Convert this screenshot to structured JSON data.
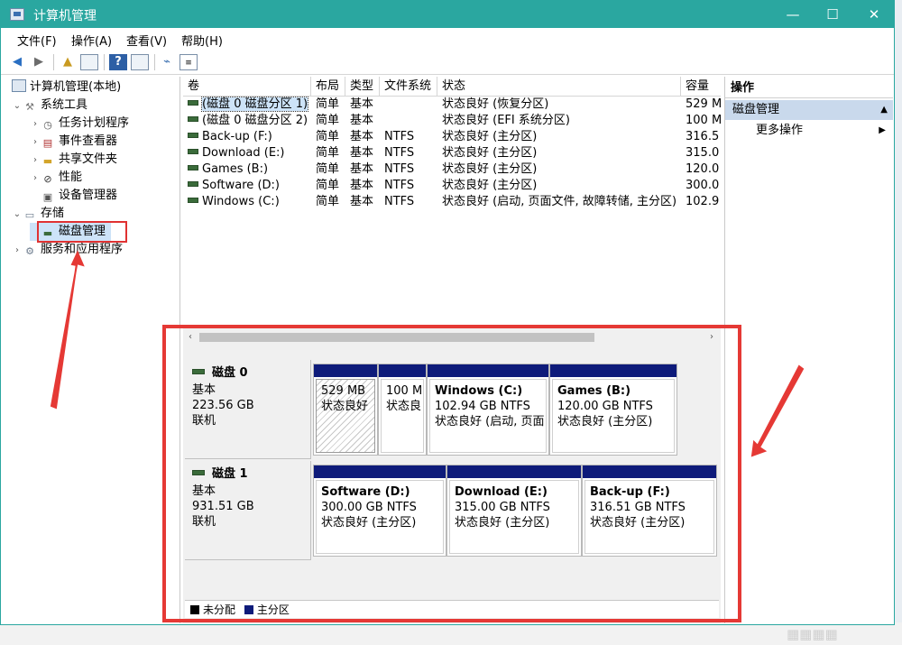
{
  "window": {
    "title": "计算机管理",
    "controls": {
      "minimize": "—",
      "maximize": "☐",
      "close": "✕"
    }
  },
  "menu": [
    "文件(F)",
    "操作(A)",
    "查看(V)",
    "帮助(H)"
  ],
  "tree": {
    "root": "计算机管理(本地)",
    "system_tools": "系统工具",
    "task_scheduler": "任务计划程序",
    "event_viewer": "事件查看器",
    "shared_folders": "共享文件夹",
    "performance": "性能",
    "device_manager": "设备管理器",
    "storage": "存储",
    "disk_management": "磁盘管理",
    "services_apps": "服务和应用程序"
  },
  "volume_list": {
    "headers": [
      "卷",
      "布局",
      "类型",
      "文件系统",
      "状态",
      "容量"
    ],
    "rows": [
      [
        "(磁盘 0 磁盘分区 1)",
        "简单",
        "基本",
        "",
        "状态良好 (恢复分区)",
        "529 M"
      ],
      [
        "(磁盘 0 磁盘分区 2)",
        "简单",
        "基本",
        "",
        "状态良好 (EFI 系统分区)",
        "100 M"
      ],
      [
        "Back-up (F:)",
        "简单",
        "基本",
        "NTFS",
        "状态良好 (主分区)",
        "316.5"
      ],
      [
        "Download (E:)",
        "简单",
        "基本",
        "NTFS",
        "状态良好 (主分区)",
        "315.0"
      ],
      [
        "Games (B:)",
        "简单",
        "基本",
        "NTFS",
        "状态良好 (主分区)",
        "120.0"
      ],
      [
        "Software (D:)",
        "简单",
        "基本",
        "NTFS",
        "状态良好 (主分区)",
        "300.0"
      ],
      [
        "Windows (C:)",
        "简单",
        "基本",
        "NTFS",
        "状态良好 (启动, 页面文件, 故障转储, 主分区)",
        "102.9"
      ]
    ]
  },
  "disks": [
    {
      "name": "磁盘 0",
      "type": "基本",
      "size": "223.56 GB",
      "status": "联机",
      "partitions": [
        {
          "name": "",
          "size": "529 MB",
          "status": "状态良好"
        },
        {
          "name": "",
          "size": "100 M",
          "status": "状态良"
        },
        {
          "name": "Windows (C:)",
          "size": "102.94 GB NTFS",
          "status": "状态良好 (启动, 页面"
        },
        {
          "name": "Games (B:)",
          "size": "120.00 GB NTFS",
          "status": "状态良好 (主分区)"
        }
      ]
    },
    {
      "name": "磁盘 1",
      "type": "基本",
      "size": "931.51 GB",
      "status": "联机",
      "partitions": [
        {
          "name": "Software (D:)",
          "size": "300.00 GB NTFS",
          "status": "状态良好 (主分区)"
        },
        {
          "name": "Download (E:)",
          "size": "315.00 GB NTFS",
          "status": "状态良好 (主分区)"
        },
        {
          "name": "Back-up (F:)",
          "size": "316.51 GB NTFS",
          "status": "状态良好 (主分区)"
        }
      ]
    }
  ],
  "legend": {
    "unallocated": "未分配",
    "primary": "主分区"
  },
  "actions": {
    "header": "操作",
    "section": "磁盘管理",
    "more": "更多操作"
  },
  "colors": {
    "titlebar": "#2aa7a0",
    "primary_partition": "#0e1b7a",
    "annotation": "#e53935"
  }
}
